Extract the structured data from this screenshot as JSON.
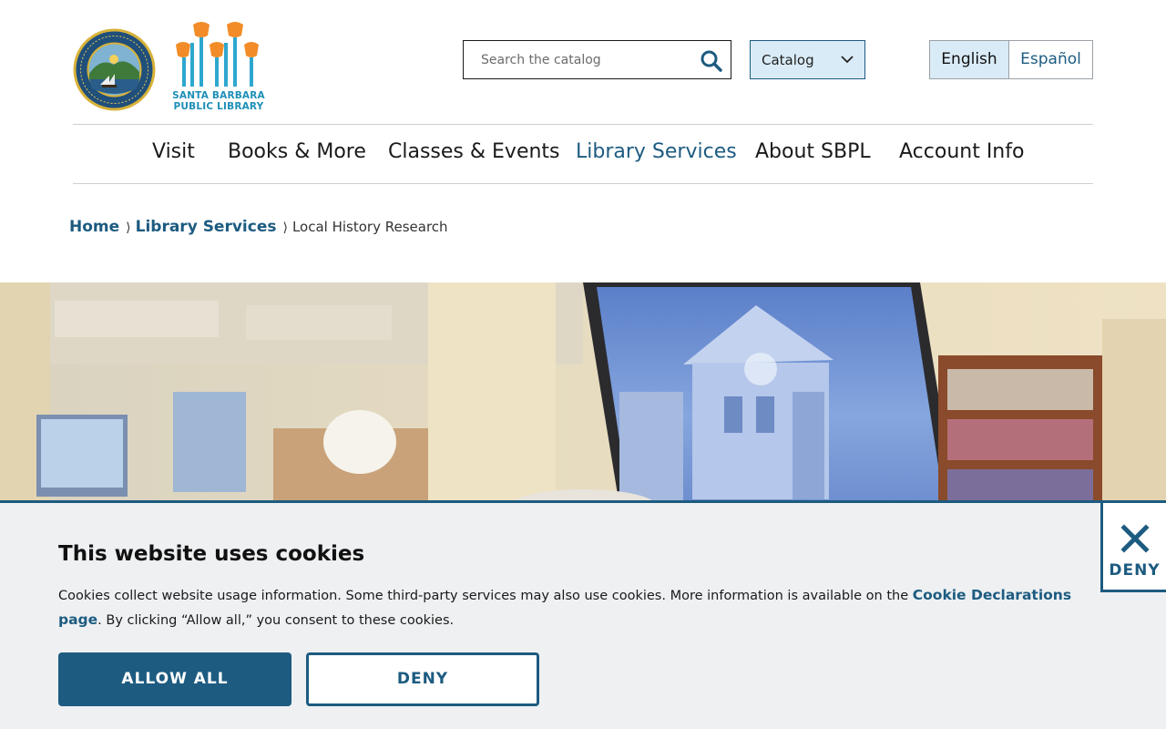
{
  "header": {
    "seal_alt": "Seal of the City of Santa Barbara California",
    "logo_text": [
      "SANTA BARBARA",
      "PUBLIC LIBRARY"
    ],
    "search": {
      "placeholder": "Search the catalog"
    },
    "catalog_select": {
      "selected": "Catalog"
    },
    "languages": [
      "English",
      "Español"
    ],
    "active_language": "English"
  },
  "nav": {
    "items": [
      "Visit",
      "Books & More",
      "Classes & Events",
      "Library Services",
      "About SBPL",
      "Account Info"
    ],
    "active": "Library Services"
  },
  "breadcrumb": {
    "home": "Home",
    "parent": "Library Services",
    "separator": "⟩",
    "current": "Local History Research"
  },
  "cookie_banner": {
    "title": "This website uses cookies",
    "text_before": "Cookies collect website usage information. Some third-party services may also use cookies. More information is available on the ",
    "link": "Cookie Declarations page",
    "text_after": ". By clicking “Allow all,” you consent to these cookies.",
    "allow_label": "ALLOW ALL",
    "deny_label": "DENY",
    "close_label": "DENY"
  },
  "colors": {
    "brand_blue": "#1d5b80",
    "highlight_bg": "#d9ebf6",
    "banner_bg": "#eef0f2",
    "logo_orange": "#f28c28",
    "logo_teal": "#1e8fb6"
  }
}
